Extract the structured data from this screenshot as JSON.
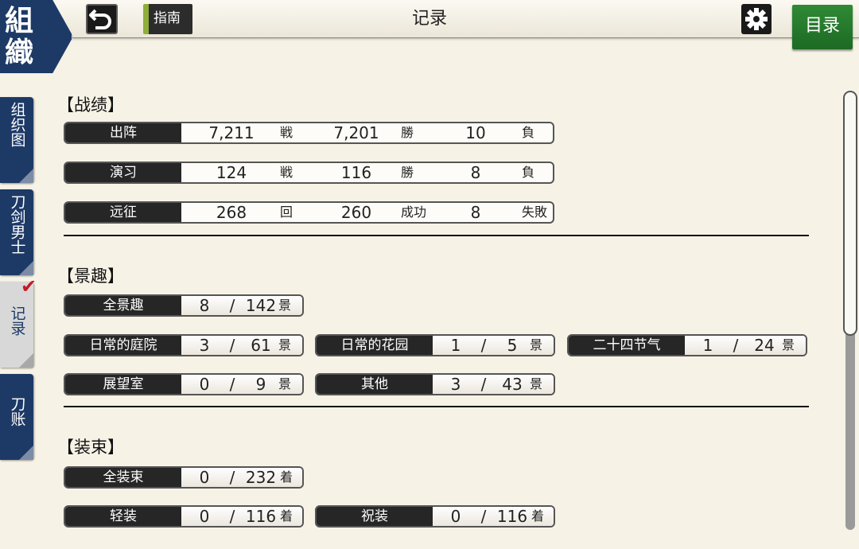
{
  "header": {
    "brand_line1": "組",
    "brand_line2": "織",
    "guide_label": "指南",
    "title": "记录",
    "menu_label": "目录"
  },
  "sidetabs": [
    {
      "label": "组织图"
    },
    {
      "label": "刀剑男士"
    },
    {
      "label": "记录"
    },
    {
      "label": "刀账"
    }
  ],
  "battle": {
    "title": "【战绩】",
    "rows": [
      {
        "label": "出阵",
        "v1": "7,211",
        "u1": "戦",
        "v2": "7,201",
        "u2": "勝",
        "v3": "10",
        "u3": "負"
      },
      {
        "label": "演习",
        "v1": "124",
        "u1": "戦",
        "v2": "116",
        "u2": "勝",
        "v3": "8",
        "u3": "負"
      },
      {
        "label": "远征",
        "v1": "268",
        "u1": "回",
        "v2": "260",
        "u2": "成功",
        "v3": "8",
        "u3": "失敗"
      }
    ]
  },
  "scenery": {
    "title": "【景趣】",
    "items": [
      {
        "label": "全景趣",
        "have": "8",
        "sep": "/",
        "total": "142",
        "unit": "景"
      },
      {
        "label": "日常的庭院",
        "have": "3",
        "sep": "/",
        "total": "61",
        "unit": "景"
      },
      {
        "label": "日常的花园",
        "have": "1",
        "sep": "/",
        "total": "5",
        "unit": "景"
      },
      {
        "label": "二十四节气",
        "have": "1",
        "sep": "/",
        "total": "24",
        "unit": "景"
      },
      {
        "label": "展望室",
        "have": "0",
        "sep": "/",
        "total": "9",
        "unit": "景"
      },
      {
        "label": "其他",
        "have": "3",
        "sep": "/",
        "total": "43",
        "unit": "景"
      }
    ]
  },
  "outfits": {
    "title": "【装束】",
    "items": [
      {
        "label": "全装束",
        "have": "0",
        "sep": "/",
        "total": "232",
        "unit": "着"
      },
      {
        "label": "轻装",
        "have": "0",
        "sep": "/",
        "total": "116",
        "unit": "着"
      },
      {
        "label": "祝装",
        "have": "0",
        "sep": "/",
        "total": "116",
        "unit": "着"
      }
    ]
  },
  "scroll": {
    "position": 0.0
  }
}
